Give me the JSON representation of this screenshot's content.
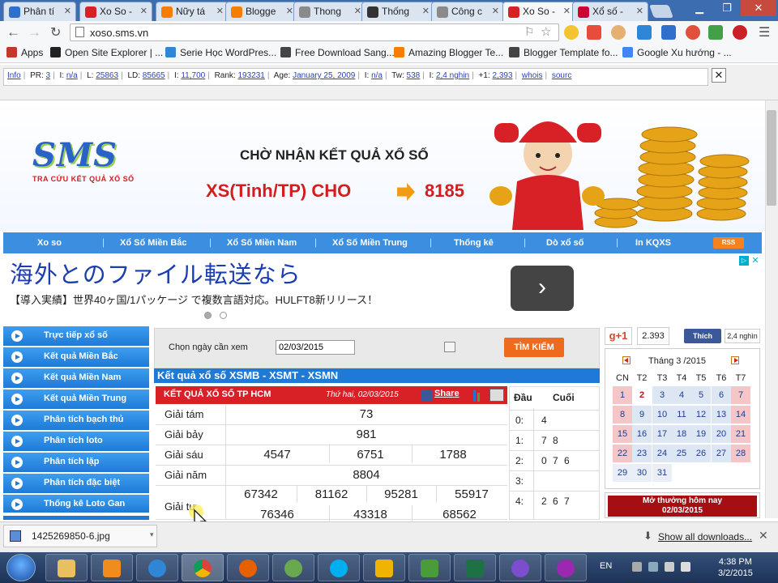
{
  "browser": {
    "tabs": [
      {
        "label": "Phân tí",
        "color": "#2f6fce"
      },
      {
        "label": "Xo So -",
        "color": "#d82027"
      },
      {
        "label": "Nữy tá",
        "color": "#f57d00"
      },
      {
        "label": "Blogge",
        "color": "#f57d00"
      },
      {
        "label": "Thong",
        "color": "#8a8a8a"
      },
      {
        "label": "Thống",
        "color": "#333"
      },
      {
        "label": "Công c",
        "color": "#8a8a8a"
      },
      {
        "label": "Xo So -",
        "color": "#d82027"
      },
      {
        "label": "Xổ số -",
        "color": "#c03"
      }
    ],
    "url": "xoso.sms.vn",
    "bookmarks": [
      {
        "label": "Apps",
        "color": "#c0392b"
      },
      {
        "label": "Open Site Explorer | ...",
        "color": "#222"
      },
      {
        "label": "Serie Học WordPres...",
        "color": "#2f86d6"
      },
      {
        "label": "Free Download Sang...",
        "color": "#444"
      },
      {
        "label": "Amazing Blogger Te...",
        "color": "#f57d00"
      },
      {
        "label": "Blogger Template fo...",
        "color": "#444"
      },
      {
        "label": "Google Xu hướng - ...",
        "color": "#4285f4"
      }
    ],
    "seobar": {
      "info": "Info",
      "pr_label": "PR:",
      "pr": "3",
      "i1_label": "I:",
      "i1": "n/a",
      "l_label": "L:",
      "l": "25863",
      "ld_label": "LD:",
      "ld": "85665",
      "b_label": "I:",
      "b": "11,700",
      "rank_label": "Rank:",
      "rank": "193231",
      "age_label": "Age:",
      "age": "January 25, 2009",
      "i2_label": "I:",
      "i2": "n/a",
      "tw_label": "Tw:",
      "tw": "538",
      "fb_label": "I:",
      "fb": "2,4 nghin",
      "gp_label": "+1:",
      "gp": "2,393",
      "whois": "whois",
      "source": "sourc"
    },
    "downloads": {
      "file": "1425269850-6.jpg",
      "show_all": "Show all downloads..."
    }
  },
  "site": {
    "logo": "SMS",
    "logo_sub": "TRA CỨU KẾT QUẢ XỔ SỐ",
    "banner_title": "CHỜ NHẬN KẾT QUẢ XỔ SỐ",
    "banner_xs": "XS(Tinh/TP) CHO",
    "banner_num": "8185",
    "nav": [
      "Xo so",
      "Xổ Số Miền Bắc",
      "Xổ Số Miền Nam",
      "Xổ Số Miền Trung",
      "Thống kê",
      "Dò xổ số",
      "In KQXS"
    ],
    "rss": "RSS",
    "ad": {
      "headline": "海外とのファイル転送なら",
      "sub": "【導入実績】世界40ヶ国/1パッケージ で複数言語対応。HULFT8新リリース！",
      "button": "›"
    },
    "sidebar": [
      "Trực tiếp xổ số",
      "Kết quả Miền Bắc",
      "Kết quả Miền Nam",
      "Kết quả Miền Trung",
      "Phân tích bạch thủ",
      "Phân tích loto",
      "Phân tích lặp",
      "Phân tích đặc biệt",
      "Thống kê Loto Gan"
    ],
    "search": {
      "label": "Chọn ngày cần xem",
      "date": "02/03/2015",
      "button": "TÌM KIẾM"
    },
    "results_title": "Kết quả xổ số XSMB - XSMT - XSMN",
    "result": {
      "title": "KẾT QUẢ XỔ SỐ TP HCM",
      "date": "Thứ hai, 02/03/2015",
      "share": "Share",
      "rows": [
        {
          "label": "Giải tám",
          "values": [
            "73"
          ]
        },
        {
          "label": "Giải bảy",
          "values": [
            "981"
          ]
        },
        {
          "label": "Giải sáu",
          "values": [
            "4547",
            "6751",
            "1788"
          ]
        },
        {
          "label": "Giải năm",
          "values": [
            "8804"
          ]
        },
        {
          "label": "Giải tư",
          "values": [
            "67342",
            "81162",
            "95281",
            "55917",
            "76346",
            "43318",
            "68562"
          ]
        }
      ]
    },
    "daududuoi": {
      "head_dau": "Đầu",
      "head_duoi": "Cuối",
      "rows": [
        {
          "dau": "0:",
          "duoi": "4"
        },
        {
          "dau": "1:",
          "duoi": "7 8"
        },
        {
          "dau": "2:",
          "duoi": "0 7 6"
        },
        {
          "dau": "3:",
          "duoi": ""
        },
        {
          "dau": "4:",
          "duoi": "2 6 7"
        }
      ]
    },
    "social": {
      "gplus": "g+1",
      "gcount": "2.393",
      "fblike": "Thích",
      "fbcount": "2,4 nghìn"
    },
    "calendar": {
      "title": "Tháng 3 /2015",
      "headers": [
        "CN",
        "T2",
        "T3",
        "T4",
        "T5",
        "T6",
        "T7"
      ],
      "days": [
        "1",
        "2",
        "3",
        "4",
        "5",
        "6",
        "7",
        "8",
        "9",
        "10",
        "11",
        "12",
        "13",
        "14",
        "15",
        "16",
        "17",
        "18",
        "19",
        "20",
        "21",
        "22",
        "23",
        "24",
        "25",
        "26",
        "27",
        "28",
        "29",
        "30",
        "31"
      ]
    },
    "open_today": {
      "line1": "Mở thưởng hôm nay",
      "line2": "02/03/2015"
    }
  },
  "taskbar": {
    "lang": "EN",
    "time": "4:38 PM",
    "date": "3/2/2015"
  }
}
